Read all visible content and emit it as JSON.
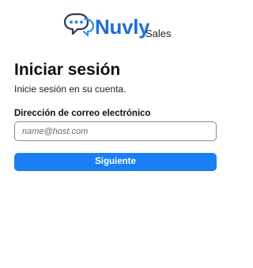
{
  "brand": {
    "name_first": "N",
    "name_rest": "uvly",
    "product": "Sales",
    "colors": {
      "primary": "#1f6fd1",
      "icon_outline": "#2b3a55",
      "icon_accent": "#2a8ff0"
    },
    "icon": "chat-bubbles-logo-icon"
  },
  "login": {
    "title": "Iniciar sesión",
    "subtitle": "Inicie sesión en su cuenta.",
    "email_label": "Dirección de correo electrónico",
    "email_value": "",
    "email_placeholder": "name@host.com",
    "next_button": "Siguiente",
    "button_color": "#1a7ff2"
  }
}
